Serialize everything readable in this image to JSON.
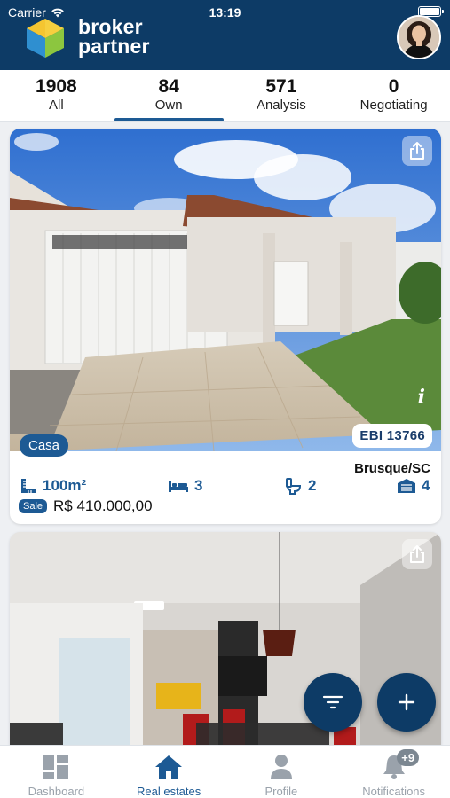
{
  "status_bar": {
    "carrier": "Carrier",
    "time": "13:19"
  },
  "header": {
    "brand_line1": "broker",
    "brand_line2": "partner"
  },
  "tabs": [
    {
      "count": "1908",
      "label": "All"
    },
    {
      "count": "84",
      "label": "Own",
      "active": true
    },
    {
      "count": "571",
      "label": "Analysis"
    },
    {
      "count": "0",
      "label": "Negotiating"
    }
  ],
  "listings": [
    {
      "type": "Casa",
      "code": "EBI 13766",
      "city": "Brusque/SC",
      "area": "100m²",
      "bedrooms": "3",
      "bathrooms": "2",
      "garages": "4",
      "sale_label": "Sale",
      "price": "R$ 410.000,00"
    }
  ],
  "bottom_nav": {
    "dashboard": "Dashboard",
    "real_estates": "Real estates",
    "profile": "Profile",
    "notifications": "Notifications",
    "notifications_badge": "+9"
  },
  "colors": {
    "primary": "#0d3b66",
    "accent": "#1d5a94",
    "muted": "#9aa2ab"
  }
}
